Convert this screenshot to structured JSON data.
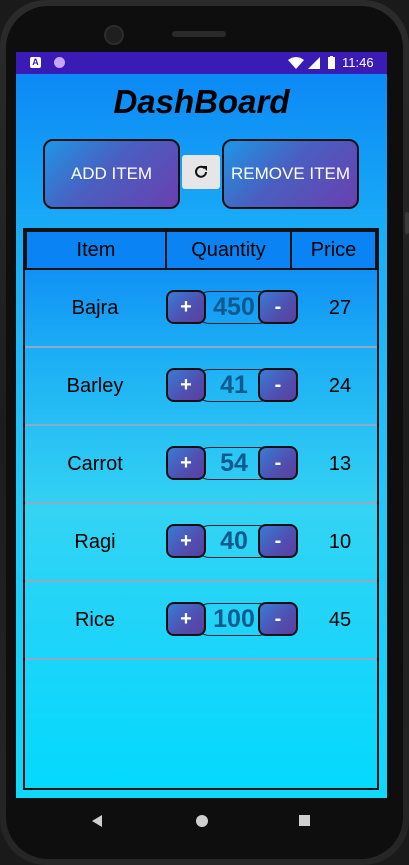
{
  "status_bar": {
    "time": "11:46",
    "icons": [
      "notification-a-icon",
      "notification-dot-icon",
      "wifi-icon",
      "signal-icon",
      "battery-icon"
    ]
  },
  "app": {
    "title": "DashBoard",
    "add_item_label": "ADD ITEM",
    "remove_item_label": "REMOVE ITEM",
    "refresh_icon": "refresh-icon"
  },
  "table": {
    "headers": [
      "Item",
      "Quantity",
      "Price"
    ],
    "rows": [
      {
        "item": "Bajra",
        "quantity": "450",
        "price": "27"
      },
      {
        "item": "Barley",
        "quantity": "41",
        "price": "24"
      },
      {
        "item": "Carrot",
        "quantity": "54",
        "price": "13"
      },
      {
        "item": "Ragi",
        "quantity": "40",
        "price": "10"
      },
      {
        "item": "Rice",
        "quantity": "100",
        "price": "45"
      }
    ],
    "increment_label": "+",
    "decrement_label": "-"
  },
  "colors": {
    "status_bar": "#3b1bb5",
    "header_cell": "#0a84f5",
    "quantity_text": "#0d5a8f",
    "button_gradient_start": "#1e96e6",
    "button_gradient_end": "#6a3fb0"
  }
}
